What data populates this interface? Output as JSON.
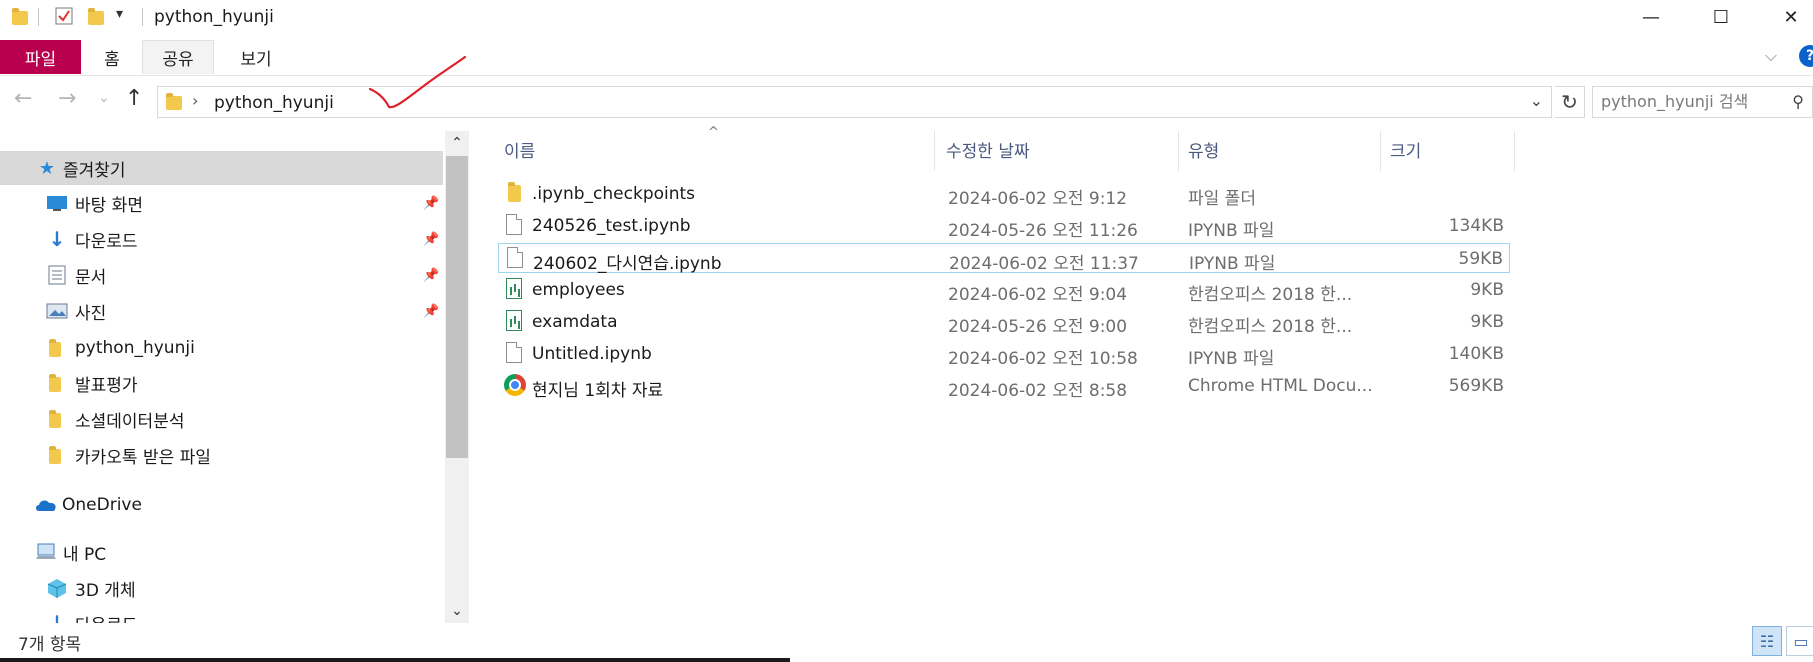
{
  "window": {
    "title": "python_hyunji",
    "minimize": "—",
    "maximize": "☐",
    "close": "✕"
  },
  "quick_access": {
    "dropdown": "▾"
  },
  "ribbon": {
    "tabs": [
      {
        "label": "파일"
      },
      {
        "label": "홈"
      },
      {
        "label": "공유"
      },
      {
        "label": "보기"
      }
    ],
    "expand": "⌵",
    "help": "?"
  },
  "navigation": {
    "back": "←",
    "forward": "→",
    "recent": "⌄",
    "up": "↑",
    "breadcrumb_sep": "›",
    "path": "python_hyunji",
    "dropdown": "⌄",
    "refresh": "↻",
    "search_placeholder": "python_hyunji 검색",
    "search_icon": "⚲"
  },
  "sidebar": {
    "items": [
      {
        "label": "즐겨찾기",
        "icon": "star-icon"
      },
      {
        "label": "바탕 화면",
        "icon": "desktop-icon",
        "pinned": true
      },
      {
        "label": "다운로드",
        "icon": "download-icon",
        "pinned": true
      },
      {
        "label": "문서",
        "icon": "documents-icon",
        "pinned": true
      },
      {
        "label": "사진",
        "icon": "pictures-icon",
        "pinned": true
      },
      {
        "label": "python_hyunji",
        "icon": "folder-icon"
      },
      {
        "label": "발표평가",
        "icon": "folder-icon"
      },
      {
        "label": "소셜데이터분석",
        "icon": "folder-icon"
      },
      {
        "label": "카카오톡 받은 파일",
        "icon": "folder-icon"
      },
      {
        "label": "OneDrive",
        "icon": "cloud-icon"
      },
      {
        "label": "내 PC",
        "icon": "computer-icon"
      },
      {
        "label": "3D 개체",
        "icon": "cube-icon"
      },
      {
        "label": "다운로드",
        "icon": "download-icon"
      }
    ],
    "pin_glyph": "📌",
    "scroll_up": "⌃",
    "scroll_down": "⌄"
  },
  "file_list": {
    "columns": [
      "이름",
      "수정한 날짜",
      "유형",
      "크기"
    ],
    "sort_indicator": "^",
    "rows": [
      {
        "name": ".ipynb_checkpoints",
        "date": "2024-06-02 오전 9:12",
        "type": "파일 폴더",
        "size": "",
        "icon": "folder-icon"
      },
      {
        "name": "240526_test.ipynb",
        "date": "2024-05-26 오전 11:26",
        "type": "IPYNB 파일",
        "size": "134KB",
        "icon": "file-icon"
      },
      {
        "name": "240602_다시연습.ipynb",
        "date": "2024-06-02 오전 11:37",
        "type": "IPYNB 파일",
        "size": "59KB",
        "icon": "file-icon",
        "selected": true
      },
      {
        "name": "employees",
        "date": "2024-06-02 오전 9:04",
        "type": "한컴오피스 2018 한...",
        "size": "9KB",
        "icon": "spreadsheet-icon"
      },
      {
        "name": "examdata",
        "date": "2024-05-26 오전 9:00",
        "type": "한컴오피스 2018 한...",
        "size": "9KB",
        "icon": "spreadsheet-icon"
      },
      {
        "name": "Untitled.ipynb",
        "date": "2024-06-02 오전 10:58",
        "type": "IPYNB 파일",
        "size": "140KB",
        "icon": "file-icon"
      },
      {
        "name": "현지님 1회차 자료",
        "date": "2024-06-02 오전 8:58",
        "type": "Chrome HTML Docu...",
        "size": "569KB",
        "icon": "chrome-icon"
      }
    ]
  },
  "status": {
    "item_count": "7개 항목",
    "details_view": "☷",
    "tiles_view": "▭"
  },
  "colors": {
    "file_tab": "#b8004e",
    "annotation": "#e0202a",
    "selection_border": "#9fd3f0",
    "header_text": "#4a5a80"
  }
}
